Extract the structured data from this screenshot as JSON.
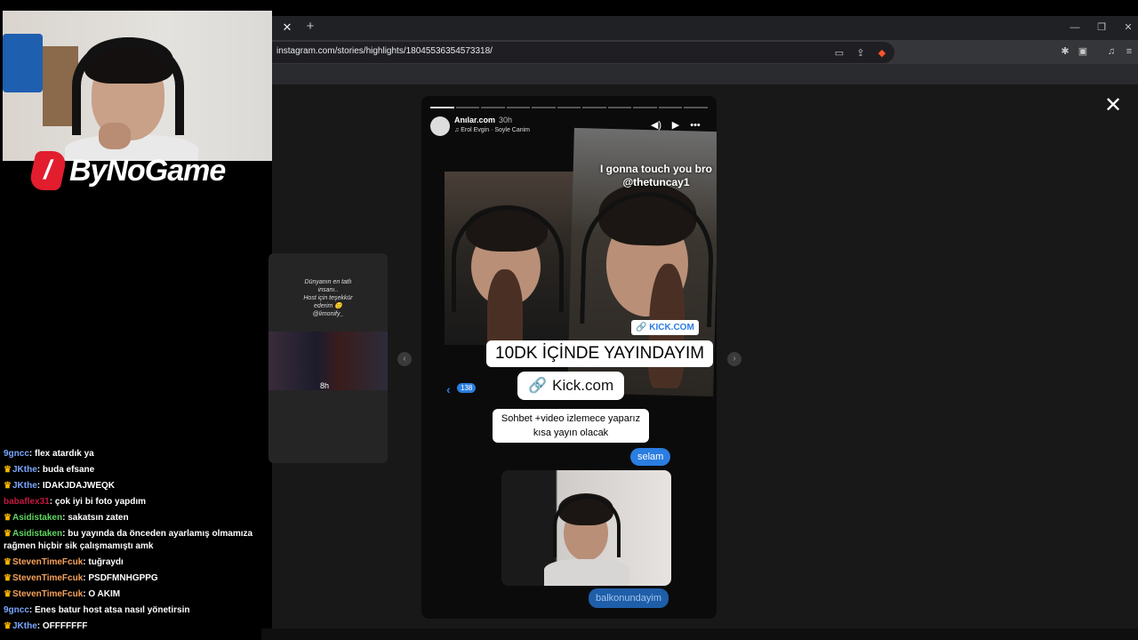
{
  "browser": {
    "tab_close": "✕",
    "new_tab": "+",
    "url": "instagram.com/stories/highlights/18045536354573318/",
    "window_controls": [
      "—",
      "❐",
      "✕"
    ]
  },
  "page": {
    "close_label": "✕",
    "prev_story": {
      "text": "Dünyanın en tatlı\ninsanı..\nHost için teşekkür\nederim 🙂\n@limonify_",
      "time": "8h"
    },
    "story": {
      "username": "Anılar.com",
      "time": "30h",
      "music": "Erol Evgin · Soyle Canim",
      "touch_caption": "I gonna touch you bro\n@thetuncay1",
      "kick_small": "🔗 KICK.COM",
      "banner": "10DK İÇİNDE YAYINDAYIM",
      "kick_big": "Kick.com",
      "kick_big_icon": "🔗",
      "sub_text": "Sohbet +video izlemece yaparız\nkısa yayın olacak",
      "back_badge": "138",
      "bubble_1": "selam",
      "bubble_2": "balkonundayim"
    }
  },
  "logo": {
    "text": "ByNoGame"
  },
  "chat": [
    {
      "user": "9gncc",
      "color": "#7aa7ff",
      "crown": false,
      "text": "flex atardık ya"
    },
    {
      "user": "JKthe",
      "color": "#7aa7ff",
      "crown": true,
      "text": "buda efsane"
    },
    {
      "user": "JKthe",
      "color": "#7aa7ff",
      "crown": true,
      "text": "IDAKJDAJWEQK"
    },
    {
      "user": "babaflex31",
      "color": "#c2183f",
      "crown": false,
      "text": "çok iyi bi foto yapdım"
    },
    {
      "user": "Asidistaken",
      "color": "#5fd65f",
      "crown": true,
      "text": "sakatsın zaten"
    },
    {
      "user": "Asidistaken",
      "color": "#5fd65f",
      "crown": true,
      "text": "bu yayında da önceden ayarlamış olmamıza rağmen hiçbir sik çalışmamıştı amk"
    },
    {
      "user": "StevenTimeFcuk",
      "color": "#f5a25d",
      "crown": true,
      "text": "tuğraydı"
    },
    {
      "user": "StevenTimeFcuk",
      "color": "#f5a25d",
      "crown": true,
      "text": "PSDFMNHGPPG"
    },
    {
      "user": "StevenTimeFcuk",
      "color": "#f5a25d",
      "crown": true,
      "text": "O AKIM"
    },
    {
      "user": "9gncc",
      "color": "#7aa7ff",
      "crown": false,
      "text": "Enes batur host atsa nasıl yönetirsin"
    },
    {
      "user": "JKthe",
      "color": "#7aa7ff",
      "crown": true,
      "text": "OFFFFFFF"
    }
  ]
}
